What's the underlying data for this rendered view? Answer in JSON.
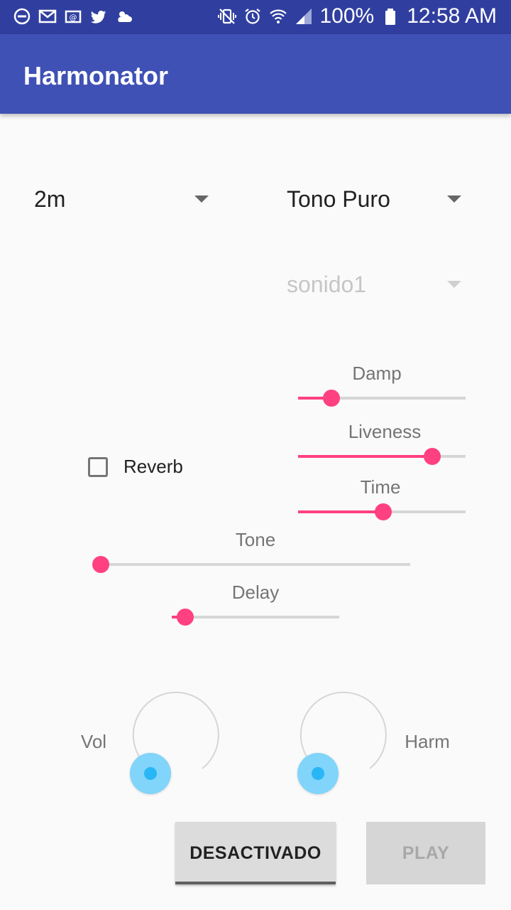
{
  "status_bar": {
    "battery": "100%",
    "time": "12:58 AM",
    "left_icons": [
      "do-not-disturb-icon",
      "gmail-icon",
      "email-icon",
      "twitter-icon",
      "weather-icon"
    ],
    "right_icons": [
      "vibrate-icon",
      "alarm-icon",
      "wifi-icon",
      "signal-icon",
      "battery-icon"
    ]
  },
  "app_bar": {
    "title": "Harmonator"
  },
  "spinners": {
    "interval": "2m",
    "tone": "Tono Puro",
    "sound": "sonido1"
  },
  "reverb": {
    "checkbox_label": "Reverb",
    "checked": false,
    "sliders": {
      "damp": {
        "label": "Damp",
        "value": 0.2
      },
      "liveness": {
        "label": "Liveness",
        "value": 0.8
      },
      "time": {
        "label": "Time",
        "value": 0.51
      }
    }
  },
  "tone_slider": {
    "label": "Tone",
    "value": 0.0
  },
  "delay_slider": {
    "label": "Delay",
    "value": 0.08
  },
  "knobs": {
    "vol": {
      "label": "Vol",
      "value": 0.0
    },
    "harm": {
      "label": "Harm",
      "value": 0.0
    }
  },
  "buttons": {
    "toggle": "DESACTIVADO",
    "play": "PLAY"
  },
  "colors": {
    "status_bar": "#303f9f",
    "app_bar": "#3f51b5",
    "accent": "#ff4081",
    "knob": "#81d4fa"
  }
}
